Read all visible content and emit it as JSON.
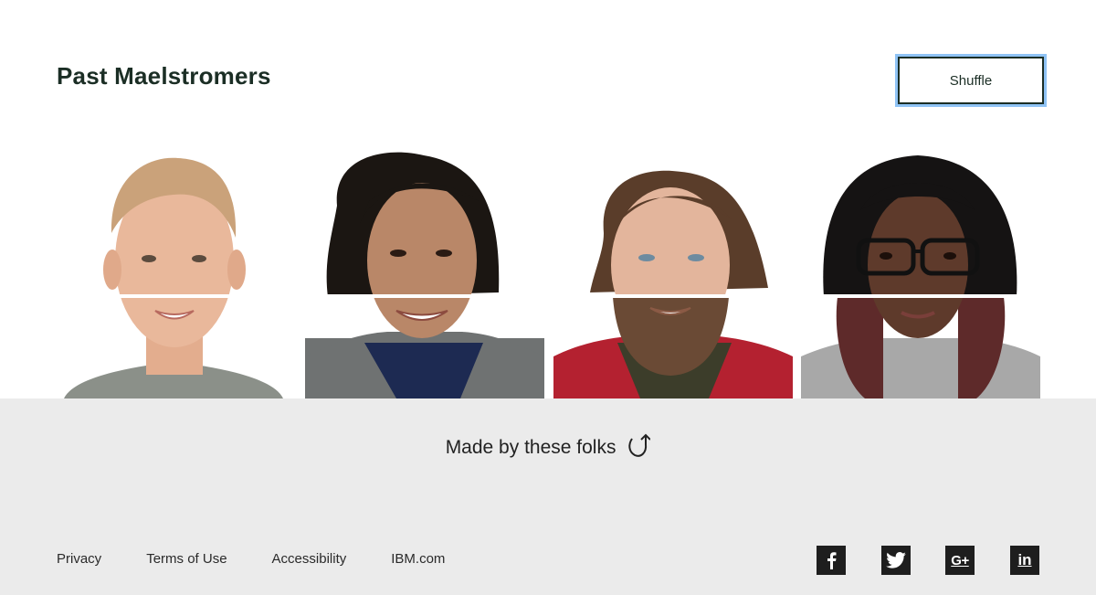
{
  "header": {
    "title": "Past Maelstromers",
    "shuffle_label": "Shuffle"
  },
  "people": [
    {
      "name": "person-1",
      "skin": "#e9b89b",
      "hair": "#caa27a",
      "shirt": "#8b9089"
    },
    {
      "name": "person-2",
      "skin": "#b98768",
      "hair": "#1b1612",
      "shirt": "#6f7272"
    },
    {
      "name": "person-3",
      "skin": "#e3b59c",
      "hair": "#5a3d2a",
      "shirt": "#b42130"
    },
    {
      "name": "person-4",
      "skin": "#5e3a2b",
      "hair": "#151313",
      "shirt": "#a8a8a8"
    }
  ],
  "footer": {
    "made_by": "Made by these folks",
    "links": [
      "Privacy",
      "Terms of Use",
      "Accessibility",
      "IBM.com"
    ],
    "social": [
      {
        "icon": "facebook-icon",
        "glyph": "f"
      },
      {
        "icon": "twitter-icon",
        "glyph": "t"
      },
      {
        "icon": "google-plus-icon",
        "glyph": "G+"
      },
      {
        "icon": "linkedin-icon",
        "glyph": "in"
      }
    ]
  }
}
